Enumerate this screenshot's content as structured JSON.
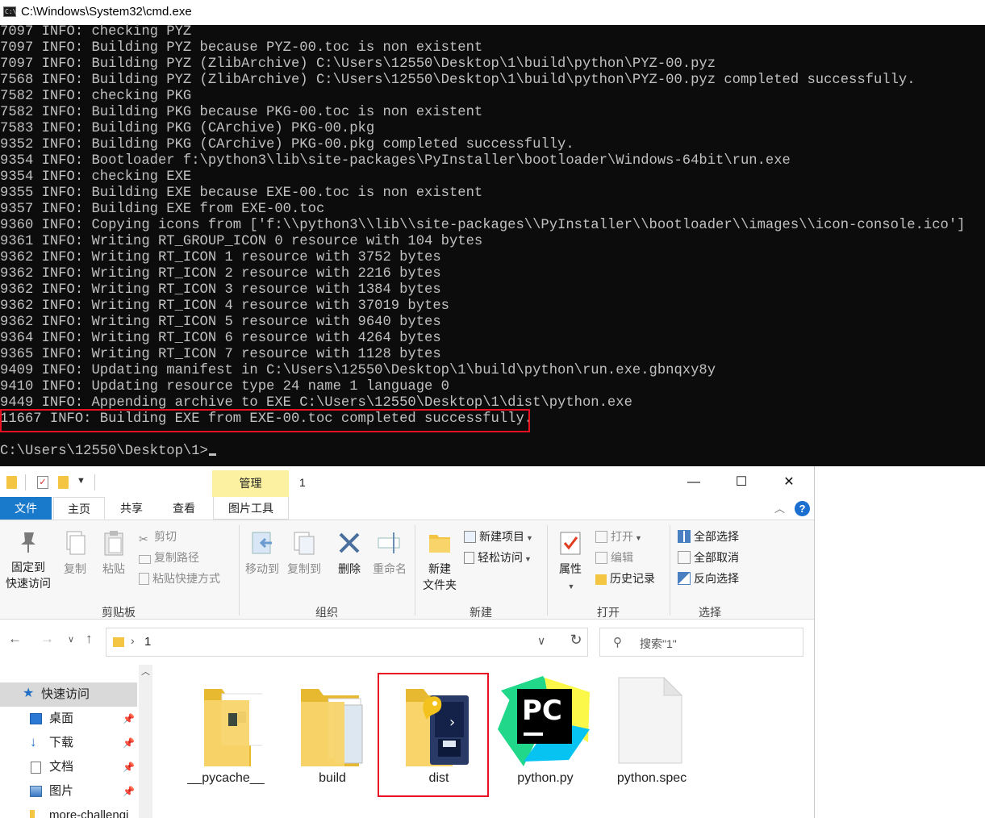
{
  "cmd": {
    "title": "C:\\Windows\\System32\\cmd.exe",
    "icon": "cmd-icon",
    "lines": [
      "7097 INFO: checking PYZ",
      "7097 INFO: Building PYZ because PYZ-00.toc is non existent",
      "7097 INFO: Building PYZ (ZlibArchive) C:\\Users\\12550\\Desktop\\1\\build\\python\\PYZ-00.pyz",
      "7568 INFO: Building PYZ (ZlibArchive) C:\\Users\\12550\\Desktop\\1\\build\\python\\PYZ-00.pyz completed successfully.",
      "7582 INFO: checking PKG",
      "7582 INFO: Building PKG because PKG-00.toc is non existent",
      "7583 INFO: Building PKG (CArchive) PKG-00.pkg",
      "9352 INFO: Building PKG (CArchive) PKG-00.pkg completed successfully.",
      "9354 INFO: Bootloader f:\\python3\\lib\\site-packages\\PyInstaller\\bootloader\\Windows-64bit\\run.exe",
      "9354 INFO: checking EXE",
      "9355 INFO: Building EXE because EXE-00.toc is non existent",
      "9357 INFO: Building EXE from EXE-00.toc",
      "9360 INFO: Copying icons from ['f:\\\\python3\\\\lib\\\\site-packages\\\\PyInstaller\\\\bootloader\\\\images\\\\icon-console.ico']",
      "9361 INFO: Writing RT_GROUP_ICON 0 resource with 104 bytes",
      "9362 INFO: Writing RT_ICON 1 resource with 3752 bytes",
      "9362 INFO: Writing RT_ICON 2 resource with 2216 bytes",
      "9362 INFO: Writing RT_ICON 3 resource with 1384 bytes",
      "9362 INFO: Writing RT_ICON 4 resource with 37019 bytes",
      "9362 INFO: Writing RT_ICON 5 resource with 9640 bytes",
      "9364 INFO: Writing RT_ICON 6 resource with 4264 bytes",
      "9365 INFO: Writing RT_ICON 7 resource with 1128 bytes",
      "9409 INFO: Updating manifest in C:\\Users\\12550\\Desktop\\1\\build\\python\\run.exe.gbnqxy8y",
      "9410 INFO: Updating resource type 24 name 1 language 0",
      "9449 INFO: Appending archive to EXE C:\\Users\\12550\\Desktop\\1\\dist\\python.exe",
      "11667 INFO: Building EXE from EXE-00.toc completed successfully."
    ],
    "prompt": "C:\\Users\\12550\\Desktop\\1>",
    "highlight_color": "#e81123"
  },
  "explorer": {
    "title": "1",
    "contextual_tab_header": "管理",
    "window_buttons": {
      "minimize": "—",
      "maximize": "☐",
      "close": "✕"
    },
    "tabs": {
      "file": "文件",
      "home": "主页",
      "share": "共享",
      "view": "查看",
      "picture_tools": "图片工具"
    },
    "help": "?",
    "ribbon": {
      "clipboard": {
        "label": "剪贴板",
        "pin_line1": "固定到",
        "pin_line2": "快速访问",
        "copy": "复制",
        "paste": "粘贴",
        "cut": "剪切",
        "copy_path": "复制路径",
        "paste_shortcut": "粘贴快捷方式"
      },
      "organize": {
        "label": "组织",
        "move_to": "移动到",
        "copy_to": "复制到",
        "delete": "删除",
        "rename": "重命名"
      },
      "new": {
        "label": "新建",
        "new_folder_line1": "新建",
        "new_folder_line2": "文件夹",
        "new_item": "新建项目",
        "easy_access": "轻松访问"
      },
      "open": {
        "label": "打开",
        "properties": "属性",
        "open": "打开",
        "edit": "编辑",
        "history": "历史记录"
      },
      "select": {
        "label": "选择",
        "select_all": "全部选择",
        "select_none": "全部取消",
        "invert": "反向选择"
      }
    },
    "address": {
      "separator": "›",
      "path": "1"
    },
    "search": {
      "placeholder": "搜索\"1\""
    },
    "nav_pane": {
      "items": [
        {
          "label": "快速访问",
          "icon": "star-icon"
        },
        {
          "label": "桌面",
          "icon": "desktop-icon",
          "pinned": true
        },
        {
          "label": "下载",
          "icon": "download-icon",
          "pinned": true
        },
        {
          "label": "文档",
          "icon": "document-icon",
          "pinned": true
        },
        {
          "label": "图片",
          "icon": "pictures-icon",
          "pinned": true
        },
        {
          "label": "more-challengi",
          "icon": "folder-icon"
        }
      ]
    },
    "files": [
      {
        "name": "__pycache__",
        "icon": "folder-icon"
      },
      {
        "name": "build",
        "icon": "folder-icon"
      },
      {
        "name": "dist",
        "icon": "folder-python-icon",
        "highlighted": true
      },
      {
        "name": "python.py",
        "icon": "pycharm-icon"
      },
      {
        "name": "python.spec",
        "icon": "blank-file-icon"
      }
    ],
    "colors": {
      "accent": "#1979ca",
      "folder": "#f4c542",
      "contextual_tab": "#fbf1a0"
    }
  }
}
